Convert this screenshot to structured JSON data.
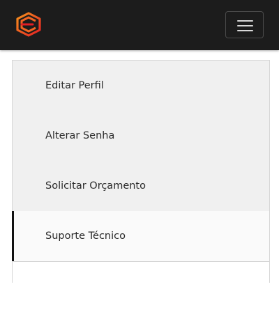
{
  "navbar": {
    "logo_icon": "brand-logo-icon",
    "toggler_icon": "hamburger-menu-icon",
    "colors": {
      "background": "#1c1c1c",
      "logo_primary": "#f26522",
      "logo_secondary": "#e31e24"
    }
  },
  "menu": {
    "items": [
      {
        "label": "Editar Perfil",
        "active": false
      },
      {
        "label": "Alterar Senha",
        "active": false
      },
      {
        "label": "Solicitar Orçamento",
        "active": false
      },
      {
        "label": "Suporte Técnico",
        "active": true
      }
    ]
  }
}
